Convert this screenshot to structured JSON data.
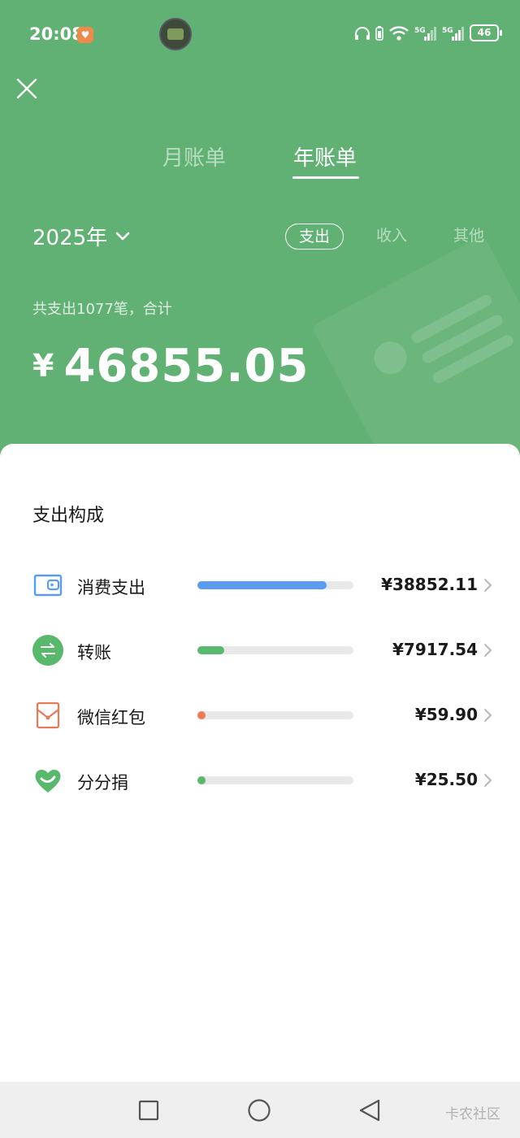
{
  "status_bar": {
    "time": "20:08",
    "battery": "46",
    "icons": [
      "heart-app-icon",
      "avatar",
      "headphones-icon",
      "battery-small-icon",
      "wifi-icon",
      "5g-signal-icon",
      "5g-signal-icon",
      "battery-icon"
    ]
  },
  "tabs": {
    "month": "月账单",
    "year": "年账单",
    "active": "year"
  },
  "filter": {
    "year": "2025年",
    "segments": [
      "支出",
      "收入",
      "其他"
    ],
    "active_segment": "支出"
  },
  "summary": {
    "text": "共支出1077笔，合计",
    "currency": "¥",
    "total": "46855.05"
  },
  "breakdown": {
    "title": "支出构成",
    "items": [
      {
        "label": "消费支出",
        "amount": "¥38852.11",
        "fraction": 0.83,
        "color": "#5b9bf2",
        "icon": "wallet-icon"
      },
      {
        "label": "转账",
        "amount": "¥7917.54",
        "fraction": 0.17,
        "color": "#58b86c",
        "icon": "transfer-icon"
      },
      {
        "label": "微信红包",
        "amount": "¥59.90",
        "fraction": 0.0013,
        "color": "#ec7a54",
        "icon": "red-packet-icon"
      },
      {
        "label": "分分捐",
        "amount": "¥25.50",
        "fraction": 0.0005,
        "color": "#58b86c",
        "icon": "donation-heart-icon"
      }
    ]
  },
  "nav": {
    "watermark": "卡农社区"
  },
  "colors": {
    "header_bg": "#61b174",
    "text_dark": "#1a1a1a",
    "track": "#e8e8e8"
  }
}
